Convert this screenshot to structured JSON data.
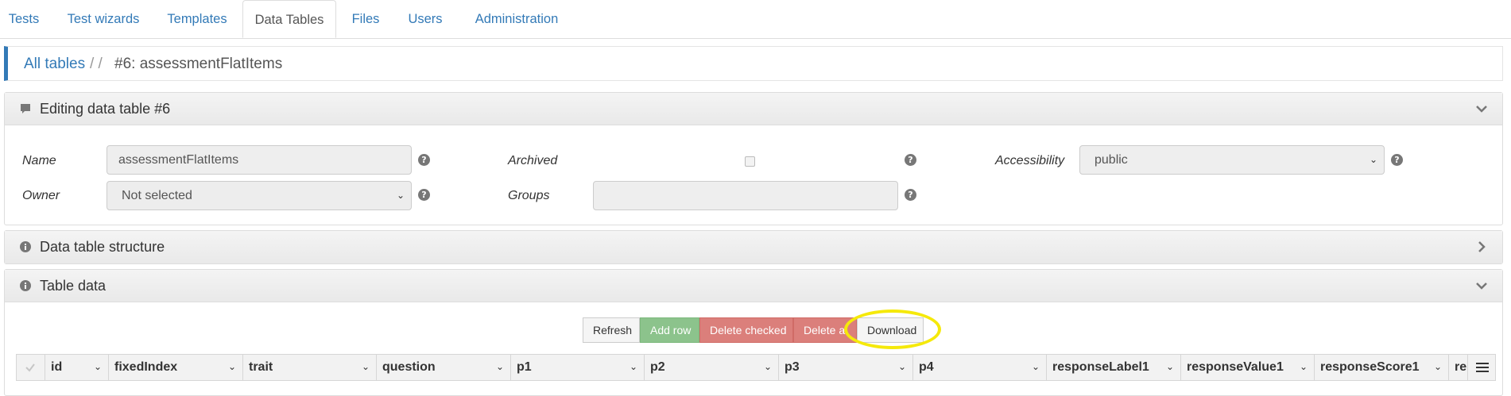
{
  "tabs": [
    {
      "label": "Tests",
      "active": false
    },
    {
      "label": "Test wizards",
      "active": false
    },
    {
      "label": "Templates",
      "active": false
    },
    {
      "label": "Data Tables",
      "active": true
    },
    {
      "label": "Files",
      "active": false
    },
    {
      "label": "Users",
      "active": false
    },
    {
      "label": "Administration",
      "active": false
    }
  ],
  "breadcrumb": {
    "link": "All tables",
    "separator": "/ /",
    "current": "#6: assessmentFlatItems"
  },
  "editing_panel": {
    "title": "Editing data table #6",
    "name_label": "Name",
    "name_value": "assessmentFlatItems",
    "owner_label": "Owner",
    "owner_value": "Not selected",
    "archived_label": "Archived",
    "archived_checked": false,
    "groups_label": "Groups",
    "groups_value": "",
    "accessibility_label": "Accessibility",
    "accessibility_value": "public"
  },
  "structure_panel": {
    "title": "Data table structure"
  },
  "table_data_panel": {
    "title": "Table data"
  },
  "toolbar": {
    "refresh": "Refresh",
    "add_row": "Add row",
    "delete_checked": "Delete checked",
    "delete_all": "Delete a",
    "download": "Download"
  },
  "columns": [
    "id",
    "fixedIndex",
    "trait",
    "question",
    "p1",
    "p2",
    "p3",
    "p4",
    "responseLabel1",
    "responseValue1",
    "responseScore1",
    "re"
  ],
  "colors": {
    "accent": "#337ab7",
    "success": "#8cc38c",
    "danger": "#db7f7b",
    "highlight": "#f5e90a"
  }
}
